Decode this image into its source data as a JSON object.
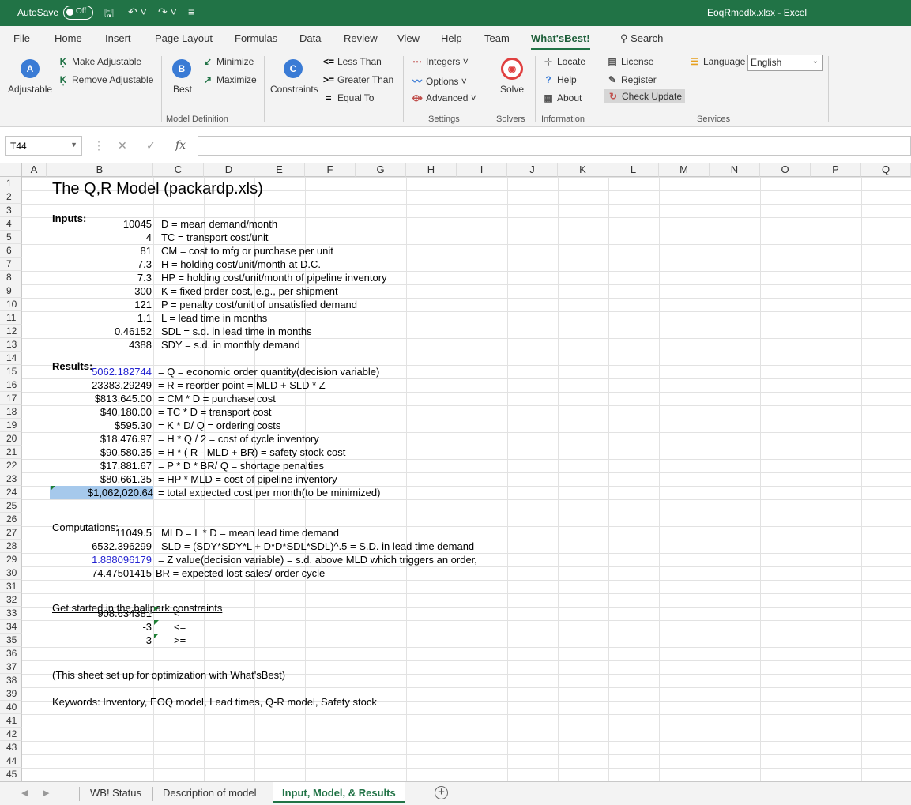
{
  "titlebar": {
    "autosave_label": "AutoSave",
    "autosave_state": "Off",
    "doc_title": "EoqRmodlx.xlsx  -  Excel",
    "bg_color": "#217346"
  },
  "tabs": [
    "File",
    "Home",
    "Insert",
    "Page Layout",
    "Formulas",
    "Data",
    "Review",
    "View",
    "Help",
    "Team",
    "What'sBest!"
  ],
  "active_tab": "What'sBest!",
  "search_label": "Search",
  "ribbon": {
    "adjustable": "Adjustable",
    "make_adjustable": "Make Adjustable",
    "remove_adjustable": "Remove Adjustable",
    "best": "Best",
    "minimize": "Minimize",
    "maximize": "Maximize",
    "constraints": "Constraints",
    "less_than": "Less Than",
    "greater_than": "Greater Than",
    "equal_to": "Equal To",
    "integers": "Integers",
    "options": "Options",
    "advanced": "Advanced",
    "solve": "Solve",
    "locate": "Locate",
    "help": "Help",
    "about": "About",
    "license": "License",
    "register": "Register",
    "check_update": "Check Update",
    "language_label": "Language",
    "language_value": "English",
    "groups": {
      "model_definition": "Model Definition",
      "settings": "Settings",
      "solvers": "Solvers",
      "information": "Information",
      "services": "Services"
    }
  },
  "formula_bar": {
    "name_box": "T44",
    "cancel": "✕",
    "enter": "✓",
    "fx": "fx",
    "formula": ""
  },
  "columns": [
    "A",
    "B",
    "C",
    "D",
    "E",
    "F",
    "G",
    "H",
    "I",
    "J",
    "K",
    "L",
    "M",
    "N",
    "O",
    "P",
    "Q"
  ],
  "rows": [
    "1",
    "2",
    "3",
    "4",
    "5",
    "6",
    "7",
    "8",
    "9",
    "10",
    "11",
    "12",
    "13",
    "14",
    "15",
    "16",
    "17",
    "18",
    "19",
    "20",
    "21",
    "22",
    "23",
    "24",
    "25",
    "26",
    "27",
    "28",
    "29",
    "30",
    "31",
    "32",
    "33",
    "34",
    "35",
    "36",
    "37",
    "38",
    "39",
    "40",
    "41",
    "42",
    "43",
    "44",
    "45"
  ],
  "sheet": {
    "title": "The Q,R  Model  (packardp.xls)",
    "inputs_label": "Inputs:",
    "inputs": [
      {
        "value": "10045",
        "desc": "D = mean demand/month"
      },
      {
        "value": "4",
        "desc": "TC = transport cost/unit"
      },
      {
        "value": "81",
        "desc": "CM = cost to mfg or purchase per unit"
      },
      {
        "value": "7.3",
        "desc": "H = holding cost/unit/month at D.C."
      },
      {
        "value": "7.3",
        "desc": "HP = holding cost/unit/month of pipeline inventory"
      },
      {
        "value": "300",
        "desc": "K = fixed order cost, e.g., per shipment"
      },
      {
        "value": "121",
        "desc": "P = penalty cost/unit of unsatisfied demand"
      },
      {
        "value": "1.1",
        "desc": "L = lead time in months"
      },
      {
        "value": "0.46152",
        "desc": "SDL = s.d. in lead time in months"
      },
      {
        "value": "4388",
        "desc": "SDY = s.d. in monthly demand"
      }
    ],
    "results_label": "Results:",
    "results": [
      {
        "value": "5062.182744",
        "desc": "= Q = economic order quantity(decision variable)"
      },
      {
        "value": "23383.29249",
        "desc": "= R = reorder point = MLD + SLD * Z"
      },
      {
        "value": "$813,645.00",
        "desc": "= CM * D = purchase cost"
      },
      {
        "value": "$40,180.00",
        "desc": "= TC * D = transport cost"
      },
      {
        "value": "$595.30",
        "desc": "= K * D/ Q = ordering costs"
      },
      {
        "value": "$18,476.97",
        "desc": "= H * Q / 2 = cost of cycle inventory"
      },
      {
        "value": "$90,580.35",
        "desc": "= H * ( R - MLD + BR) = safety stock cost"
      },
      {
        "value": "$17,881.67",
        "desc": "= P * D * BR/ Q = shortage penalties"
      },
      {
        "value": "$80,661.35",
        "desc": "= HP * MLD = cost of pipeline inventory"
      },
      {
        "value": "$1,062,020.64",
        "desc": "= total expected cost per month(to be minimized)"
      }
    ],
    "computations_label": "Computations:",
    "computations": [
      {
        "value": "11049.5",
        "desc": "MLD = L * D = mean lead time demand"
      },
      {
        "value": "6532.396299",
        "desc": "SLD = (SDY*SDY*L + D*D*SDL*SDL)^.5 = S.D. in lead time demand"
      },
      {
        "value": "1.888096179",
        "desc": "= Z  value(decision variable) = s.d. above MLD which triggers an order,"
      },
      {
        "value": "74.47501415",
        "desc": "BR = expected lost sales/ order cycle"
      }
    ],
    "constraints_label": "Get started in the ballpark constraints",
    "constraints": [
      {
        "value": "908.634381",
        "op": "<="
      },
      {
        "value": "-3",
        "op": "<="
      },
      {
        "value": "3",
        "op": ">="
      }
    ],
    "note": "(This sheet set up for optimization with What'sBest)",
    "keywords": "Keywords: Inventory, EOQ model, Lead times, Q-R model, Safety stock"
  },
  "sheet_tabs": [
    "WB! Status",
    "Description of model",
    "Input, Model, & Results"
  ],
  "active_sheet": "Input, Model, & Results",
  "add_sheet": "+"
}
